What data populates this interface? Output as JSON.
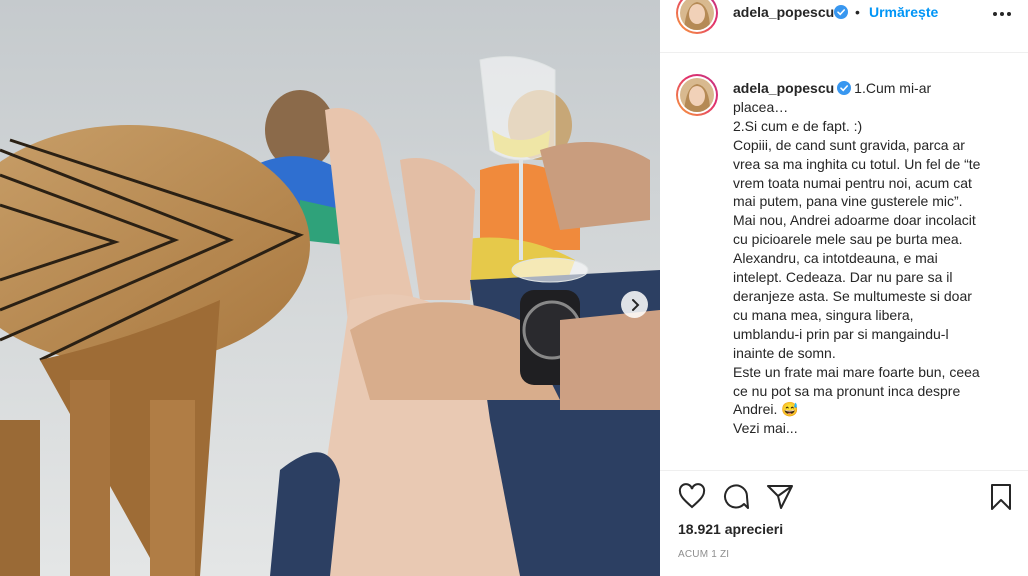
{
  "post": {
    "username": "adela_popescu",
    "verified": true,
    "follow_label": "Urmărește",
    "separator": "•",
    "caption_lines": [
      "1.Cum mi-ar placea…",
      "2.Si cum e de fapt. :)",
      "Copiii, de cand sunt gravida, parca ar vrea sa ma inghita cu totul. Un fel de “te vrem toata numai pentru noi, acum cat mai putem, pana vine gusterele mic”.",
      "Mai nou, Andrei adoarme doar incolacit cu picioarele mele sau pe burta mea.",
      "Alexandru, ca intotdeauna, e mai intelept. Cedeaza. Dar nu pare sa il deranjeze asta. Se multumeste si doar cu mana mea, singura libera, umblandu-i prin par si mangaindu-l inainte de somn.",
      "Este un frate mai mare foarte bun, ceea ce nu pot sa ma pronunt inca despre Andrei. 😅",
      "Vezi mai..."
    ],
    "likes": "18.921 aprecieri",
    "timestamp": "Acum 1 zi"
  },
  "icons": {
    "verified": "verified-badge-icon",
    "more": "more-options-icon",
    "like": "heart-icon",
    "comment": "comment-icon",
    "share": "send-icon",
    "save": "bookmark-icon",
    "carousel_next": "chevron-right-icon"
  },
  "colors": {
    "accent": "#0095f6",
    "verified": "#3897f0",
    "text": "#262626",
    "muted": "#8e8e8e"
  }
}
